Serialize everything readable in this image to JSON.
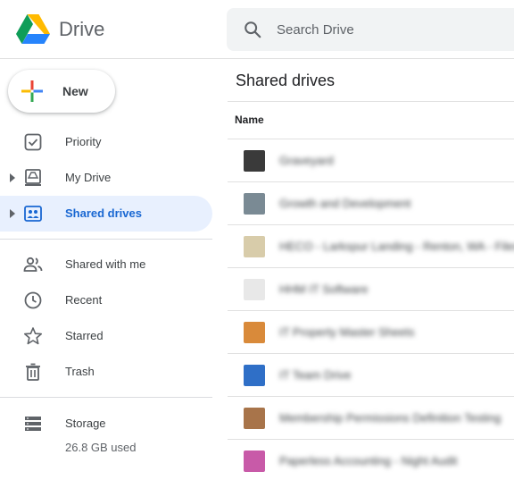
{
  "app": {
    "brand": "Drive"
  },
  "search": {
    "placeholder": "Search Drive"
  },
  "new_button": {
    "label": "New"
  },
  "sidebar": {
    "items": [
      {
        "label": "Priority",
        "icon": "check-box-icon"
      },
      {
        "label": "My Drive",
        "icon": "my-drive-icon"
      },
      {
        "label": "Shared drives",
        "icon": "shared-drives-icon",
        "active": true
      },
      {
        "label": "Shared with me",
        "icon": "people-icon"
      },
      {
        "label": "Recent",
        "icon": "clock-icon"
      },
      {
        "label": "Starred",
        "icon": "star-icon"
      },
      {
        "label": "Trash",
        "icon": "trash-icon"
      }
    ],
    "storage": {
      "label": "Storage",
      "used": "26.8 GB used"
    }
  },
  "main": {
    "title": "Shared drives",
    "column_header": "Name",
    "rows": [
      {
        "name": "Graveyard",
        "thumb": "#3a3a3a"
      },
      {
        "name": "Growth and Development",
        "thumb": "#7a8a94"
      },
      {
        "name": "HECO - Larkspur Landing - Renton, WA - Files",
        "thumb": "#d8ccaa"
      },
      {
        "name": "HHM IT Software",
        "thumb": "#e8e8e8"
      },
      {
        "name": "IT Property Master Sheets",
        "thumb": "#d98a3a"
      },
      {
        "name": "IT Team Drive",
        "thumb": "#2f6fc7"
      },
      {
        "name": "Membership Permissions Definition Testing",
        "thumb": "#a8744a"
      },
      {
        "name": "Paperless Accounting - Night Audit",
        "thumb": "#c85aa8"
      }
    ]
  },
  "colors": {
    "accent": "#1967d2",
    "active_bg": "#e8f0fe"
  }
}
